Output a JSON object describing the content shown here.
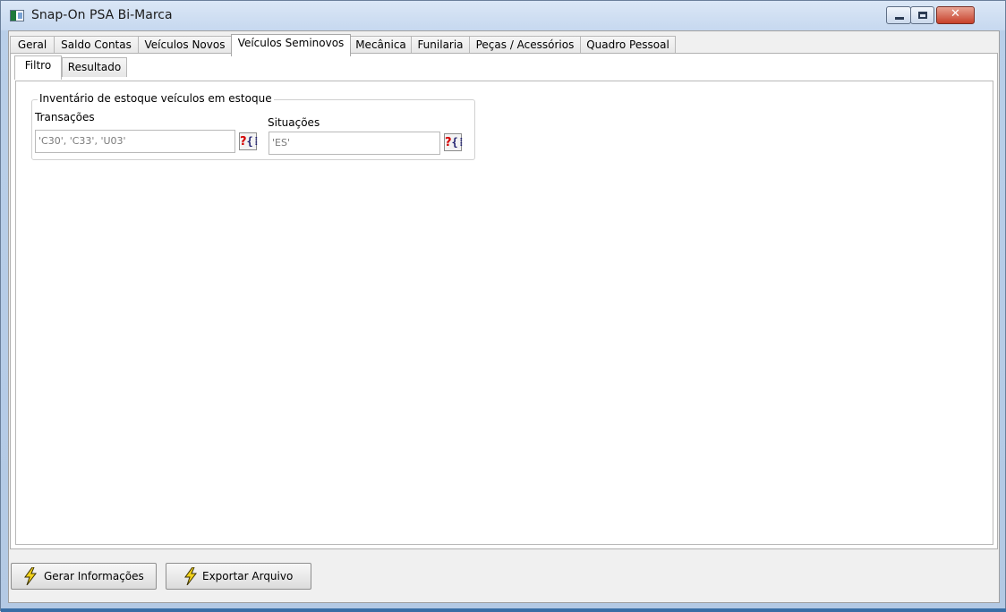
{
  "window": {
    "title": "Snap-On PSA Bi-Marca",
    "controls": {
      "minimize": "minimize",
      "maximize": "maximize",
      "close": "✕"
    }
  },
  "main_tabs": [
    {
      "label": "Geral"
    },
    {
      "label": "Saldo Contas"
    },
    {
      "label": "Veículos Novos"
    },
    {
      "label": "Veículos Seminovos",
      "active": true
    },
    {
      "label": "Mecânica"
    },
    {
      "label": "Funilaria"
    },
    {
      "label": "Peças / Acessórios"
    },
    {
      "label": "Quadro Pessoal"
    }
  ],
  "sub_tabs": [
    {
      "label": "Filtro",
      "active": true
    },
    {
      "label": "Resultado"
    }
  ],
  "filter_group": {
    "legend": "Inventário de estoque veículos em estoque",
    "transacoes": {
      "label": "Transações",
      "value": "'C30', 'C33', 'U03'"
    },
    "situacoes": {
      "label": "Situações",
      "value": "'ES'"
    },
    "lookup_button": {
      "q": "?",
      "brace": "{⁞"
    }
  },
  "actions": {
    "gerar": "Gerar Informações",
    "exportar": "Exportar Arquivo"
  },
  "colors": {
    "lookup_question": "#d40000",
    "bolt_fill": "#f2d21b",
    "bolt_stroke": "#3a3000",
    "title_bar": "#c6d8ef",
    "close_button": "#c7402a"
  }
}
